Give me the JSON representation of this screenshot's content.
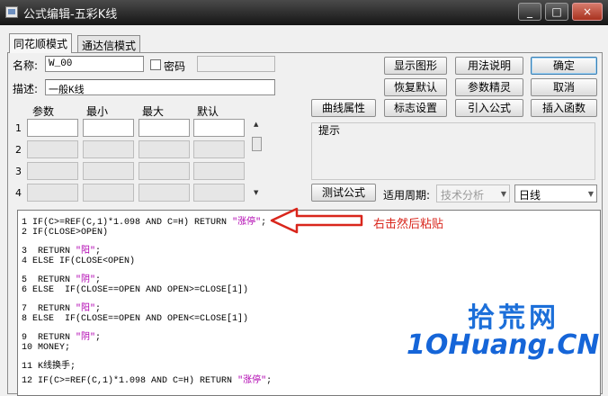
{
  "window": {
    "title": "公式编辑-五彩K线",
    "controls": {
      "minimize": "_",
      "maximize": "□",
      "close": "×"
    }
  },
  "tabs": [
    {
      "label": "同花顺模式",
      "active": true
    },
    {
      "label": "通达信模式",
      "active": false
    }
  ],
  "form": {
    "name_label": "名称:",
    "name_value": "W_00",
    "password_label": "密码",
    "password_checked": false,
    "desc_label": "描述:",
    "desc_value": "一般K线"
  },
  "buttons": {
    "show_chart": "显示图形",
    "usage": "用法说明",
    "ok": "确定",
    "restore_default": "恢复默认",
    "param_tune": "参数精灵",
    "cancel": "取消",
    "curve_props": "曲线属性",
    "flag_settings": "标志设置",
    "import_formula": "引入公式",
    "insert_func": "插入函数",
    "test_formula": "测试公式"
  },
  "params": {
    "headers": [
      "参数",
      "最小",
      "最大",
      "默认"
    ],
    "rows": [
      "1",
      "2",
      "3",
      "4"
    ]
  },
  "hint": {
    "title": "提示"
  },
  "period": {
    "label": "适用周期:",
    "category": "技术分析",
    "value": "日线"
  },
  "code": {
    "lines": [
      {
        "n": "1",
        "parts": [
          [
            "IF(C>=REF(C,1)*1.098 AND C=H) RETURN ",
            "kw"
          ],
          [
            "\"涨停\"",
            "str"
          ],
          [
            ";",
            "kw"
          ]
        ]
      },
      {
        "n": "2",
        "parts": [
          [
            "IF(CLOSE>OPEN)",
            "kw"
          ]
        ]
      },
      {
        "n": "3",
        "parts": [
          [
            " RETURN ",
            "kw"
          ],
          [
            "\"阳\"",
            "str"
          ],
          [
            ";",
            "kw"
          ]
        ]
      },
      {
        "n": "4",
        "parts": [
          [
            "ELSE IF(CLOSE<OPEN)",
            "kw"
          ]
        ]
      },
      {
        "n": "5",
        "parts": [
          [
            " RETURN ",
            "kw"
          ],
          [
            "\"阴\"",
            "str"
          ],
          [
            ";",
            "kw"
          ]
        ]
      },
      {
        "n": "6",
        "parts": [
          [
            "ELSE  IF(CLOSE==OPEN AND OPEN>=CLOSE[1])",
            "kw"
          ]
        ]
      },
      {
        "n": "7",
        "parts": [
          [
            " RETURN ",
            "kw"
          ],
          [
            "\"阳\"",
            "str"
          ],
          [
            ";",
            "kw"
          ]
        ]
      },
      {
        "n": "8",
        "parts": [
          [
            "ELSE  IF(CLOSE==OPEN AND OPEN<=CLOSE[1])",
            "kw"
          ]
        ]
      },
      {
        "n": "9",
        "parts": [
          [
            " RETURN ",
            "kw"
          ],
          [
            "\"阴\"",
            "str"
          ],
          [
            ";",
            "kw"
          ]
        ]
      },
      {
        "n": "10",
        "parts": [
          [
            "MONEY;",
            "kw"
          ]
        ]
      },
      {
        "n": "11",
        "parts": [
          [
            "K线换手;",
            "kw"
          ]
        ]
      },
      {
        "n": "12",
        "parts": [
          [
            "IF(C>=REF(C,1)*1.098 AND C=H) RETURN ",
            "kw"
          ],
          [
            "\"涨停\"",
            "str"
          ],
          [
            ";",
            "kw"
          ]
        ]
      }
    ]
  },
  "annotation": {
    "text": "右击然后粘贴",
    "color": "#d9261c"
  },
  "watermark": {
    "line1": "拾荒网",
    "line2": "1OHuang.CN",
    "color": "#1565d8"
  }
}
